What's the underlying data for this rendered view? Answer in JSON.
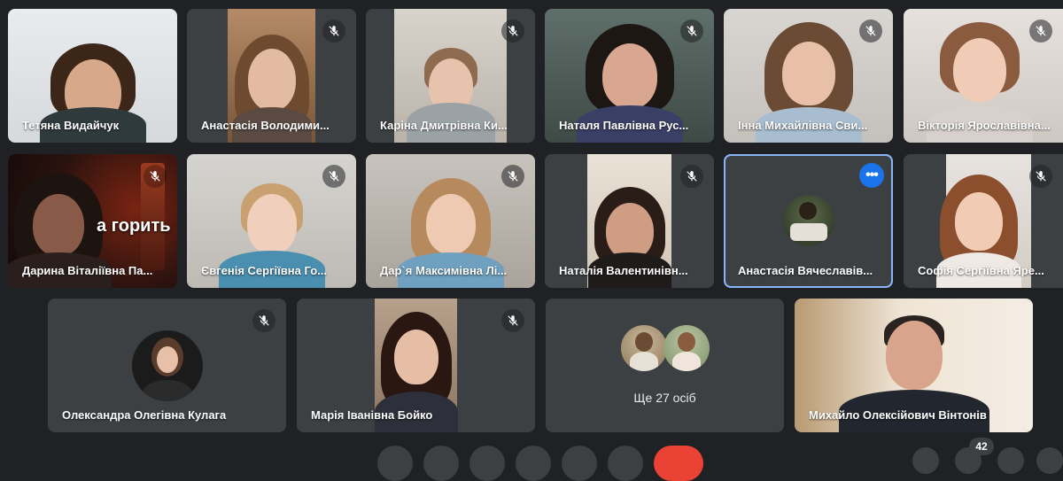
{
  "participants": [
    {
      "name": "Тетяна Видайчук"
    },
    {
      "name": "Анастасія Володими..."
    },
    {
      "name": "Каріна Дмитрівна Ки..."
    },
    {
      "name": "Наталя Павлівна Рус..."
    },
    {
      "name": "Інна Михайлівна Сви..."
    },
    {
      "name": "Вікторія Ярославівна..."
    },
    {
      "name": "Дарина Віталіївна Па...",
      "overlay": "а горить"
    },
    {
      "name": "Євгенія Сергіївна Го..."
    },
    {
      "name": "Дар`я Максимівна Лі..."
    },
    {
      "name": "Наталія Валентинівн..."
    },
    {
      "name": "Анастасія Вячеславів..."
    },
    {
      "name": "Софія Сергіївна Яре..."
    },
    {
      "name": "Олександра Олегівна Кулага"
    },
    {
      "name": "Марія Іванівна Бойко"
    },
    {
      "name": "Михайло Олексійович Вінтонів"
    }
  ],
  "more_participants": {
    "label": "Ще 27 осіб"
  },
  "participant_count": "42",
  "colors": {
    "background": "#202124",
    "tile": "#3c4043",
    "selected_border": "#8ab4f8",
    "accent": "#1a73e8",
    "end_call": "#ea4335"
  },
  "icons": {
    "mute": "mic-off-icon",
    "more": "more-options-icon"
  }
}
